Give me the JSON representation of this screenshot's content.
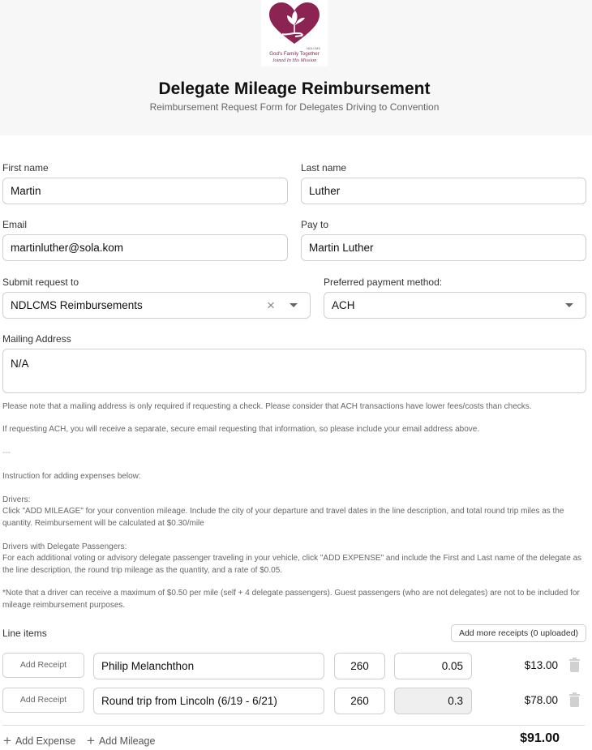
{
  "logo": {
    "line1": "God's Family Together",
    "line2": "Joined In His Mission"
  },
  "header": {
    "title": "Delegate Mileage Reimbursement",
    "subtitle": "Reimbursement Request Form for Delegates Driving to Convention"
  },
  "form": {
    "first_name": {
      "label": "First name",
      "value": "Martin"
    },
    "last_name": {
      "label": "Last name",
      "value": "Luther"
    },
    "email": {
      "label": "Email",
      "value": "martinluther@sola.kom"
    },
    "pay_to": {
      "label": "Pay to",
      "value": "Martin Luther"
    },
    "submit_to": {
      "label": "Submit request to",
      "value": "NDLCMS Reimbursements"
    },
    "payment_method": {
      "label": "Preferred payment method:",
      "value": "ACH"
    },
    "mailing_address": {
      "label": "Mailing Address",
      "value": "N/A"
    }
  },
  "notes": {
    "mailing_note": "Please note that a mailing address is only required if requesting a check. Please consider that ACH transactions have lower fees/costs than checks.",
    "ach_note": "If requesting ACH, you will receive a separate, secure email requesting that information, so please include your email address above.",
    "separator": "---",
    "instruction_heading": "Instruction for adding expenses below:",
    "drivers_heading": "Drivers:",
    "drivers_text": "Click \"ADD MILEAGE\" for your convention mileage. Include the city of your departure and travel dates in the line description, and total round trip miles as the quantity. Reimbursement will be calculated at $0.30/mile",
    "passengers_heading": "Drivers with Delegate Passengers:",
    "passengers_text": "For each additional voting or advisory delegate passenger traveling in your vehicle, click \"ADD EXPENSE\" and include the First and Last name of the delegate as the line description, the round trip mileage as the quantity, and a rate of $0.05.",
    "max_note": "*Note that a driver can receive a maximum of $0.50 per mile (self + 4 delegate passengers). Guest passengers (who are not delegates) are not to be included for mileage reimbursement purposes."
  },
  "line_items": {
    "label": "Line items",
    "add_receipts_label": "Add more receipts (0 uploaded)",
    "receipt_button_label": "Add Receipt",
    "rows": [
      {
        "description": "Philip Melanchthon",
        "quantity": "260",
        "rate": "0.05",
        "amount": "$13.00"
      },
      {
        "description": "Round trip from Lincoln (6/19 - 6/21)",
        "quantity": "260",
        "rate": "0.3",
        "amount": "$78.00"
      }
    ],
    "add_expense_label": "Add Expense",
    "add_mileage_label": "Add Mileage",
    "total": "$91.00"
  },
  "colors": {
    "brand": "#8b2453",
    "header_bg": "#f7f7f7"
  }
}
